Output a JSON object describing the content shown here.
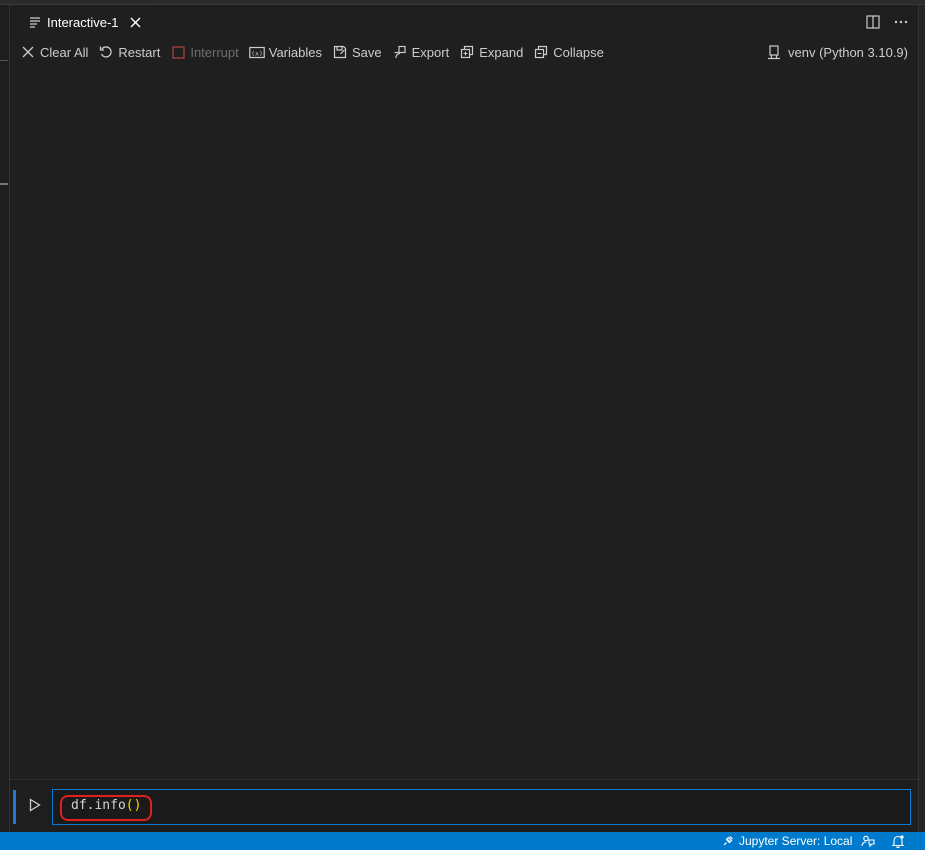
{
  "tab": {
    "icon": "notebook-list-icon",
    "title": "Interactive-1",
    "close_icon": "close-icon"
  },
  "tab_actions": [
    {
      "name": "split-editor-icon"
    },
    {
      "name": "more-actions-icon"
    }
  ],
  "toolbar": {
    "items": [
      {
        "label": "Clear All",
        "icon": "clear-all-icon",
        "disabled": false
      },
      {
        "label": "Restart",
        "icon": "restart-icon",
        "disabled": false
      },
      {
        "label": "Interrupt",
        "icon": "interrupt-icon",
        "disabled": true
      },
      {
        "label": "Variables",
        "icon": "variables-icon",
        "disabled": false
      },
      {
        "label": "Save",
        "icon": "save-icon",
        "disabled": false
      },
      {
        "label": "Export",
        "icon": "export-icon",
        "disabled": false
      },
      {
        "label": "Expand",
        "icon": "expand-icon",
        "disabled": false
      },
      {
        "label": "Collapse",
        "icon": "collapse-icon",
        "disabled": false
      }
    ],
    "kernel": {
      "label": "venv (Python 3.10.9)",
      "icon": "kernel-icon"
    }
  },
  "input": {
    "code_prefix": "df.info",
    "code_parens": "()",
    "run_icon": "run-icon"
  },
  "statusbar": {
    "jupyter_server": "Jupyter Server: Local",
    "feedback_icon": "feedback-icon",
    "bell_icon": "bell-icon"
  },
  "colors": {
    "accent": "#007acc",
    "editor_bg": "#1f1f1f",
    "highlight": "#e02020",
    "paren": "#ffd700"
  }
}
